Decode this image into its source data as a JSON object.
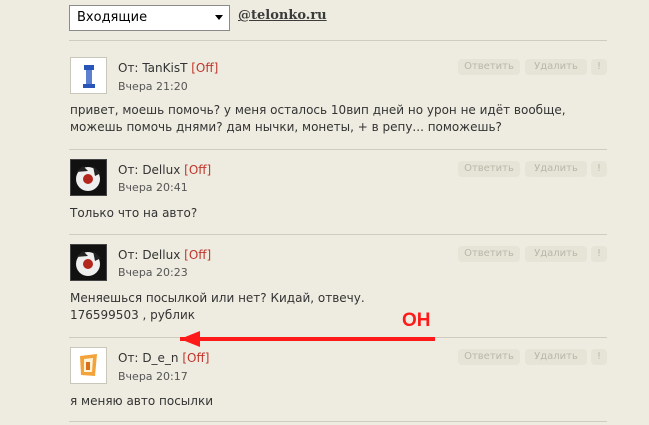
{
  "header": {
    "folder_selected": "Входящие",
    "domain": "@telonko.ru"
  },
  "actions": {
    "reply": "Ответить",
    "delete": "Удалить",
    "mark": "!"
  },
  "messages": [
    {
      "from_prefix": "От:",
      "sender": "TanKisT",
      "status": "[Off]",
      "date": "Вчера 21:20",
      "text_line1": "привет, моешь помочь? у меня осталось 10вип дней но урон не идёт вообще,",
      "text_line2": "можешь помочь днями? дам нычки, монеты, + в репу... поможешь?"
    },
    {
      "from_prefix": "От:",
      "sender": "Dellux",
      "status": "[Off]",
      "date": "Вчера 20:41",
      "text_line1": "Только что на авто?"
    },
    {
      "from_prefix": "От:",
      "sender": "Dellux",
      "status": "[Off]",
      "date": "Вчера 20:23",
      "text_line1": "Меняешься посылкой или нет? Кидай, отвечу.",
      "text_line2": "176599503 , рублик"
    },
    {
      "from_prefix": "От:",
      "sender": "D_e_n",
      "status": "[Off]",
      "date": "Вчера 20:17",
      "text_line1": "я меняю авто посылки"
    }
  ],
  "annotation": {
    "label": "ОН",
    "color": "#ff1a1a"
  }
}
